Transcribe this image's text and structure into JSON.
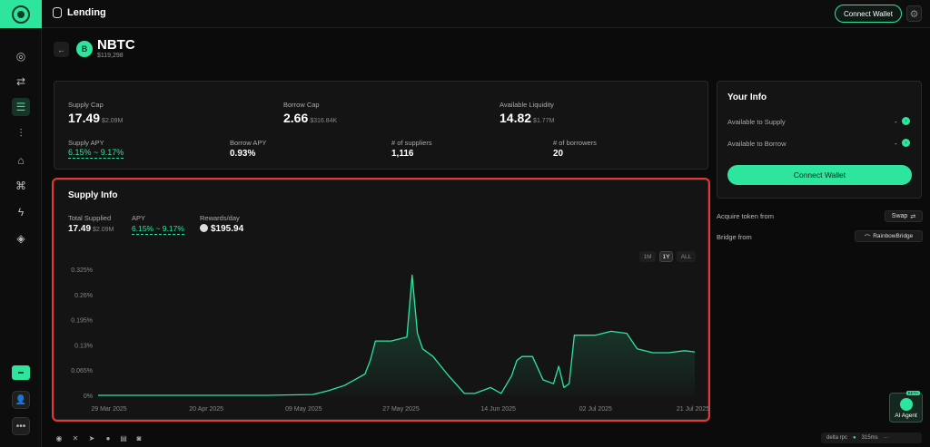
{
  "topbar": {
    "section_title": "Lending",
    "connect_wallet": "Connect Wallet"
  },
  "asset": {
    "name": "NBTC",
    "price": "$119,298",
    "icon_letter": "B"
  },
  "stats": {
    "supply_cap_label": "Supply Cap",
    "supply_cap_value": "17.49",
    "supply_cap_usd": "$2.09M",
    "borrow_cap_label": "Borrow Cap",
    "borrow_cap_value": "2.66",
    "borrow_cap_usd": "$316.84K",
    "liquidity_label": "Available Liquidity",
    "liquidity_value": "14.82",
    "liquidity_usd": "$1.77M",
    "supply_apy_label": "Supply APY",
    "supply_apy_value": "6.15% ~ 9.17%",
    "borrow_apy_label": "Borrow APY",
    "borrow_apy_value": "0.93%",
    "suppliers_label": "# of suppliers",
    "suppliers_value": "1,116",
    "borrowers_label": "# of borrowers",
    "borrowers_value": "20"
  },
  "your_info": {
    "title": "Your Info",
    "supply_label": "Available to Supply",
    "supply_value": "-",
    "borrow_label": "Available to Borrow",
    "borrow_value": "-",
    "connect_wallet": "Connect Wallet"
  },
  "acquire": {
    "label": "Acquire token from",
    "button": "Swap",
    "bridge_label": "Bridge from",
    "bridge_button": "RainbowBridge"
  },
  "supply_info": {
    "title": "Supply Info",
    "total_label": "Total Supplied",
    "total_value": "17.49",
    "total_usd": "$2.09M",
    "apy_label": "APY",
    "apy_value": "6.15% ~ 9.17%",
    "rewards_label": "Rewards/day",
    "rewards_value": "$195.94",
    "ranges": [
      "1M",
      "1Y",
      "ALL"
    ],
    "selected_range": "1Y"
  },
  "chart_data": {
    "type": "area",
    "color": "#2ee59d",
    "y_ticks": [
      "0%",
      "0.065%",
      "0.13%",
      "0.195%",
      "0.26%",
      "0.325%"
    ],
    "x_ticks": [
      "29 Mar 2025",
      "20 Apr 2025",
      "09 May 2025",
      "27 May 2025",
      "14 Jun 2025",
      "02 Jul 2025",
      "21 Jul 2025"
    ],
    "ylim": [
      0,
      0.325
    ],
    "xlim": [
      "2025-03-29",
      "2025-07-21"
    ],
    "x": [
      "2025-03-29",
      "2025-04-10",
      "2025-04-20",
      "2025-04-30",
      "2025-05-09",
      "2025-05-12",
      "2025-05-15",
      "2025-05-17",
      "2025-05-19",
      "2025-05-20",
      "2025-05-21",
      "2025-05-24",
      "2025-05-27",
      "2025-05-28",
      "2025-05-29",
      "2025-05-30",
      "2025-06-01",
      "2025-06-04",
      "2025-06-07",
      "2025-06-09",
      "2025-06-12",
      "2025-06-14",
      "2025-06-16",
      "2025-06-17",
      "2025-06-18",
      "2025-06-20",
      "2025-06-22",
      "2025-06-24",
      "2025-06-25",
      "2025-06-26",
      "2025-06-27",
      "2025-06-28",
      "2025-06-30",
      "2025-07-02",
      "2025-07-05",
      "2025-07-08",
      "2025-07-10",
      "2025-07-13",
      "2025-07-16",
      "2025-07-19",
      "2025-07-21"
    ],
    "values": [
      0,
      0,
      0,
      0,
      0.002,
      0.012,
      0.025,
      0.04,
      0.055,
      0.09,
      0.14,
      0.14,
      0.15,
      0.31,
      0.16,
      0.12,
      0.1,
      0.05,
      0.005,
      0.005,
      0.02,
      0.005,
      0.05,
      0.09,
      0.1,
      0.1,
      0.04,
      0.03,
      0.075,
      0.02,
      0.03,
      0.155,
      0.155,
      0.155,
      0.165,
      0.16,
      0.12,
      0.11,
      0.11,
      0.115,
      0.112
    ]
  },
  "ai_agent": {
    "label": "AI Agent",
    "badge": "BETA"
  },
  "footer": {
    "rpc_label": "delta rpc",
    "latency": "315ms"
  }
}
